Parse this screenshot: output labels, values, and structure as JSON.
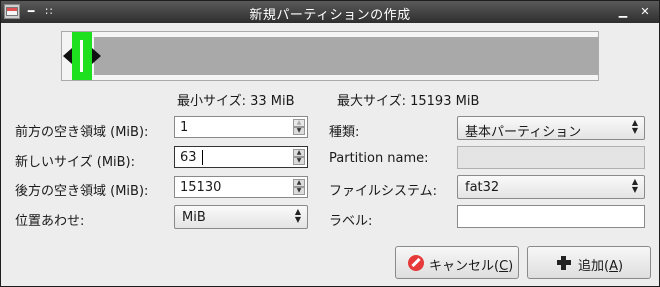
{
  "window": {
    "title": "新規パーティションの作成",
    "controls": {
      "minimize": "▁",
      "close": "✕"
    },
    "menu_glyph": "━",
    "pin_glyph": "∷"
  },
  "size_info": {
    "min_label": "最小サイズ: 33 MiB",
    "max_label": "最大サイズ: 15193 MiB"
  },
  "partition_map": {
    "partition_fraction": 0.004,
    "free_after_fraction": 0.996
  },
  "left_form": {
    "free_before_label": "前方の空き領域 (MiB):",
    "free_before_value": "1",
    "new_size_label": "新しいサイズ (MiB):",
    "new_size_value": "63",
    "free_after_label": "後方の空き領域 (MiB):",
    "free_after_value": "15130",
    "align_label": "位置あわせ:",
    "align_value": "MiB"
  },
  "right_form": {
    "type_label": "種類:",
    "type_value": "基本パーティション",
    "partition_name_label": "Partition name:",
    "partition_name_value": "",
    "filesystem_label": "ファイルシステム:",
    "filesystem_value": "fat32",
    "label_label": "ラベル:",
    "label_value": ""
  },
  "buttons": {
    "cancel_text": "キャンセル(",
    "cancel_mnemonic": "C",
    "cancel_close": ")",
    "add_text": "追加(",
    "add_mnemonic": "A",
    "add_close": ")"
  },
  "icons": {
    "cancel": "cancel-icon",
    "add": "plus-icon"
  },
  "colors": {
    "partition_used": "#1ee01e",
    "free_space": "#a9a9a9",
    "titlebar": "#3a3a3a"
  }
}
